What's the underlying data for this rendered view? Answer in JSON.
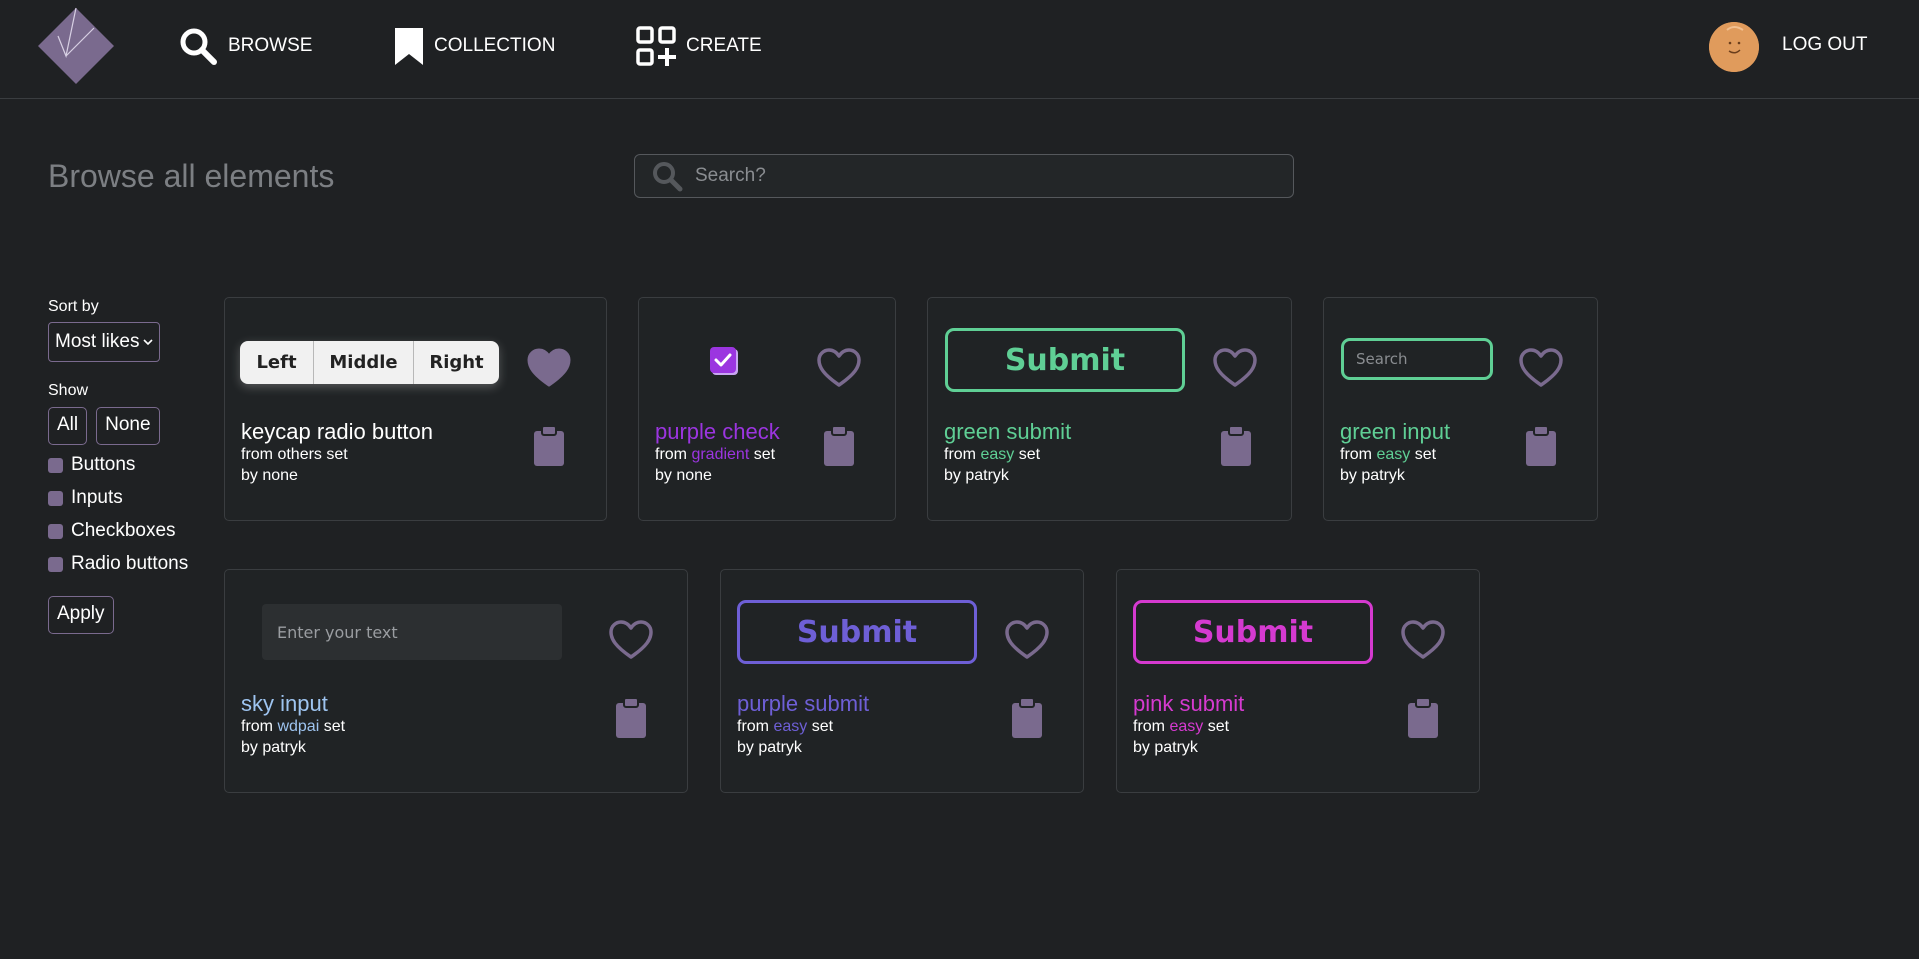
{
  "nav": {
    "browse": "BROWSE",
    "collection": "COLLECTION",
    "create": "CREATE",
    "logout": "LOG OUT"
  },
  "page": {
    "title": "Browse all elements",
    "search_placeholder": "Search?"
  },
  "filters": {
    "sort_label": "Sort by",
    "sort_value": "Most likes",
    "show_label": "Show",
    "all_label": "All",
    "none_label": "None",
    "types": [
      "Buttons",
      "Inputs",
      "Checkboxes",
      "Radio buttons"
    ],
    "apply_label": "Apply"
  },
  "colors": {
    "accent": "#7a6a8e",
    "green": "#5fcf95",
    "purple_check": "#9b35e0",
    "purple_submit": "#6e5fd6",
    "pink": "#d53ad0",
    "sky": "#9ec4f0"
  },
  "cards": [
    {
      "title": "keycap radio button",
      "set_prefix": "from",
      "set_name": "others",
      "set_suffix": "set",
      "author": "by none",
      "liked": true,
      "demo": {
        "left": "Left",
        "middle": "Middle",
        "right": "Right"
      }
    },
    {
      "title": "purple check",
      "set_prefix": "from",
      "set_name": "gradient",
      "set_suffix": "set",
      "author": "by none",
      "liked": false,
      "demo": {
        "checked": true
      }
    },
    {
      "title": "green submit",
      "set_prefix": "from",
      "set_name": "easy",
      "set_suffix": "set",
      "author": "by patryk",
      "liked": false,
      "demo": {
        "label": "Submit"
      }
    },
    {
      "title": "green input",
      "set_prefix": "from",
      "set_name": "easy",
      "set_suffix": "set",
      "author": "by patryk",
      "liked": false,
      "demo": {
        "placeholder": "Search"
      }
    },
    {
      "title": "sky input",
      "set_prefix": "from",
      "set_name": "wdpai",
      "set_suffix": "set",
      "author": "by patryk",
      "liked": false,
      "demo": {
        "placeholder": "Enter your text"
      }
    },
    {
      "title": "purple submit",
      "set_prefix": "from",
      "set_name": "easy",
      "set_suffix": "set",
      "author": "by patryk",
      "liked": false,
      "demo": {
        "label": "Submit"
      }
    },
    {
      "title": "pink submit",
      "set_prefix": "from",
      "set_name": "easy",
      "set_suffix": "set",
      "author": "by patryk",
      "liked": false,
      "demo": {
        "label": "Submit"
      }
    }
  ]
}
